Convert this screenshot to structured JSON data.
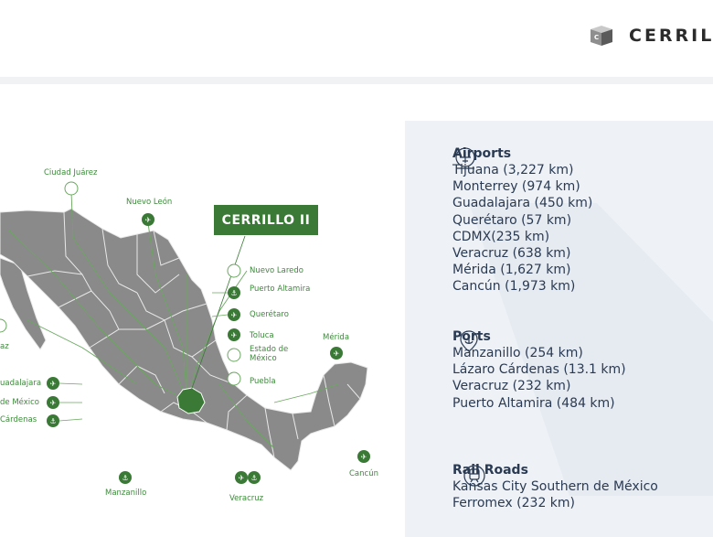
{
  "brand": {
    "name": "CERRILLO",
    "logo_letters": "C"
  },
  "callout": {
    "label": "CERRILLO II"
  },
  "map_labels": {
    "ciudad_juarez": "Ciudad Juárez",
    "nuevo_leon": "Nuevo León",
    "nuevo_laredo": "Nuevo Laredo",
    "puerto_altamira": "Puerto Altamira",
    "queretaro": "Querétaro",
    "toluca": "Toluca",
    "estado_de_mexico": "Estado de México",
    "puebla": "Puebla",
    "merida": "Mérida",
    "cancun": "Cancún",
    "veracruz": "Veracruz",
    "manzanillo": "Manzanillo",
    "guadalajara": "uadalajara",
    "de_mexico": "de México",
    "cardenas": "Cárdenas",
    "paz": "az"
  },
  "airports": {
    "title": "Airports",
    "items": [
      "Tijuana (3,227 km)",
      "Monterrey (974 km)",
      "Guadalajara (450 km)",
      "Querétaro (57 km)",
      "CDMX(235 km)",
      "Veracruz (638 km)",
      "Mérida (1,627 km)",
      "Cancún (1,973 km)"
    ]
  },
  "ports": {
    "title": "Ports",
    "items": [
      "Manzanillo (254 km)",
      "Lázaro Cárdenas (13.1 km)",
      "Veracruz (232 km)",
      "Puerto Altamira (484 km)"
    ]
  },
  "railroads": {
    "title": "Rail Roads",
    "items": [
      "Kansas City Southern de México",
      "Ferromex (232 km)"
    ]
  },
  "colors": {
    "accent_green": "#3a7a36",
    "map_gray": "#8a8a8a",
    "panel_bg": "#eef2f7",
    "text_navy": "#2a3a52"
  }
}
